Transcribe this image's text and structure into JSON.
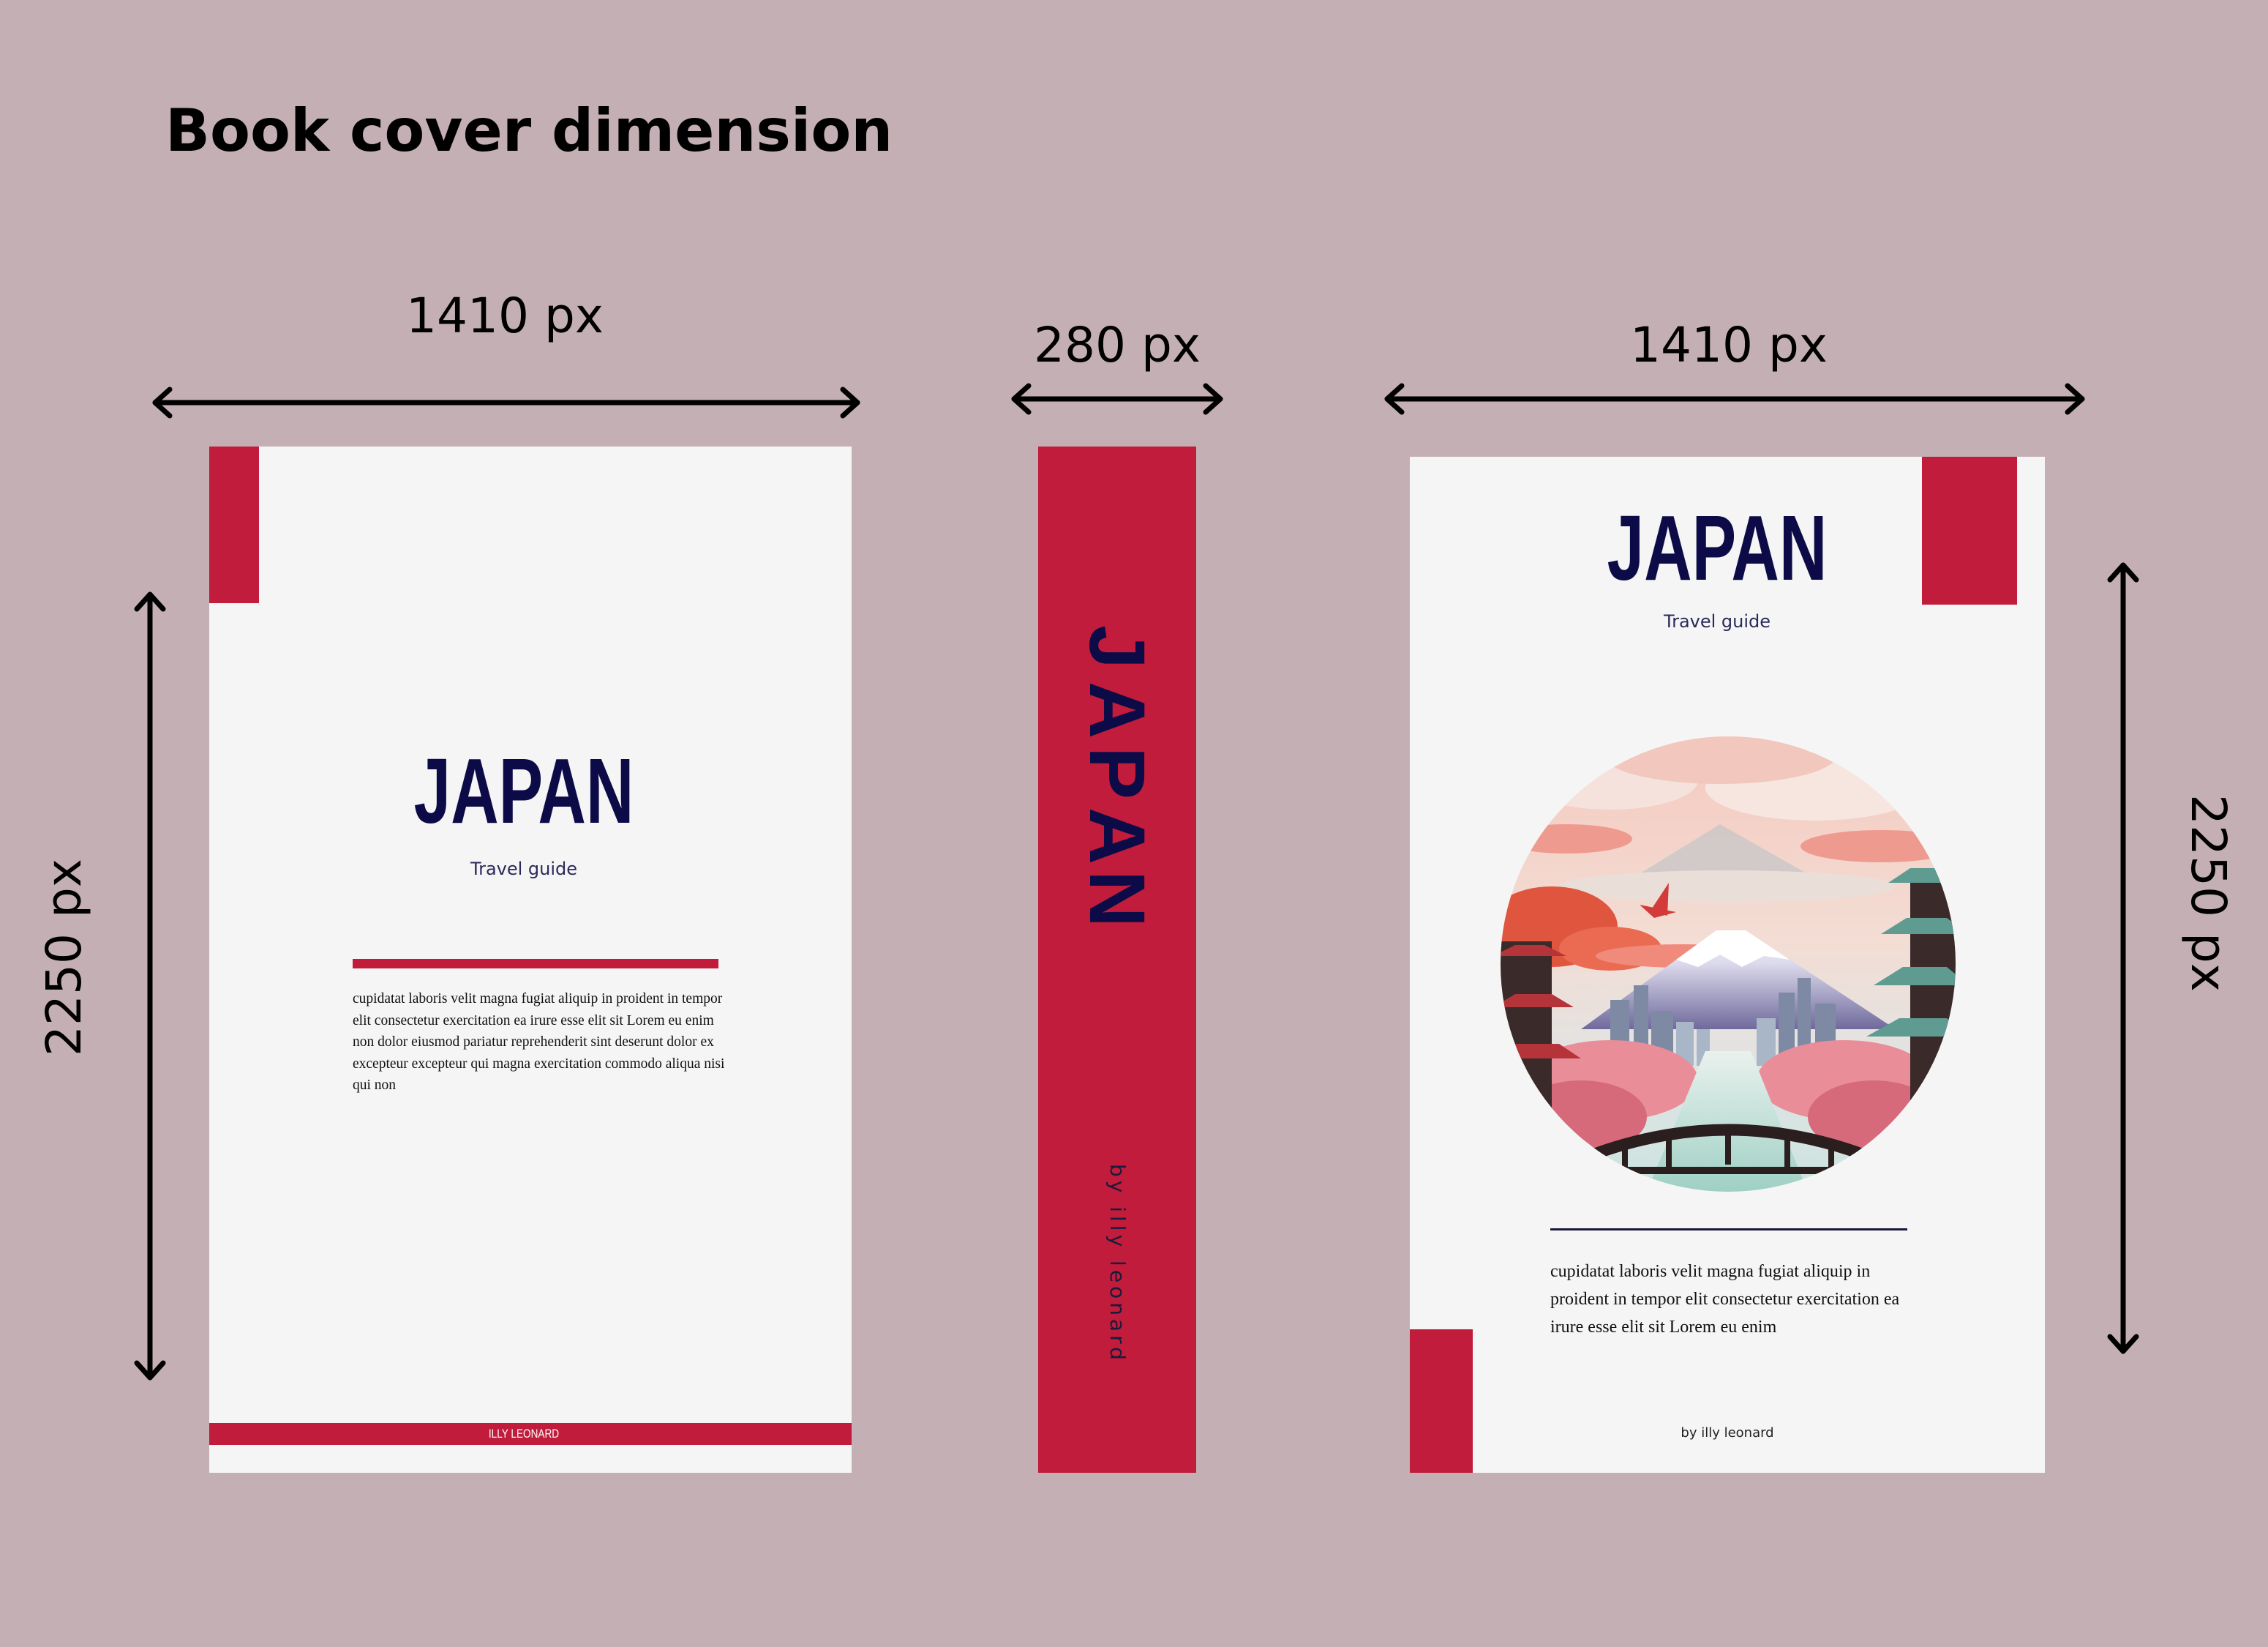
{
  "page": {
    "title": "Book cover dimension"
  },
  "dimensions": {
    "back_width": "1410 px",
    "spine_width": "280 px",
    "front_width": "1410 px",
    "left_height": "2250 px",
    "right_height": "2250 px"
  },
  "back_cover": {
    "title": "JAPAN",
    "subtitle": "Travel guide",
    "body": "cupidatat laboris velit magna fugiat aliquip in proident in tempor elit consectetur exercitation ea irure esse elit sit Lorem eu enim non dolor eiusmod pariatur reprehenderit sint deserunt dolor ex excepteur excepteur qui magna exercitation commodo aliqua nisi qui non",
    "footer_author": "ILLY LEONARD"
  },
  "spine": {
    "title": "JAPAN",
    "letters": [
      "J",
      "A",
      "P",
      "A",
      "N"
    ],
    "author": "by illy leonard"
  },
  "front_cover": {
    "title": "JAPAN",
    "subtitle": "Travel guide",
    "illustration": "circular illustration of Mount Fuji with pagodas, cherry blossoms, city skyline, river and bridge",
    "body": "cupidatat laboris velit magna fugiat aliquip in proident in tempor elit consectetur exercitation ea irure esse elit sit Lorem eu enim",
    "author": "by illy leonard"
  },
  "colors": {
    "background": "#c4b0b4",
    "accent_red": "#c11c3b",
    "title_navy": "#0d0b47",
    "cover_white": "#f5f5f5"
  }
}
